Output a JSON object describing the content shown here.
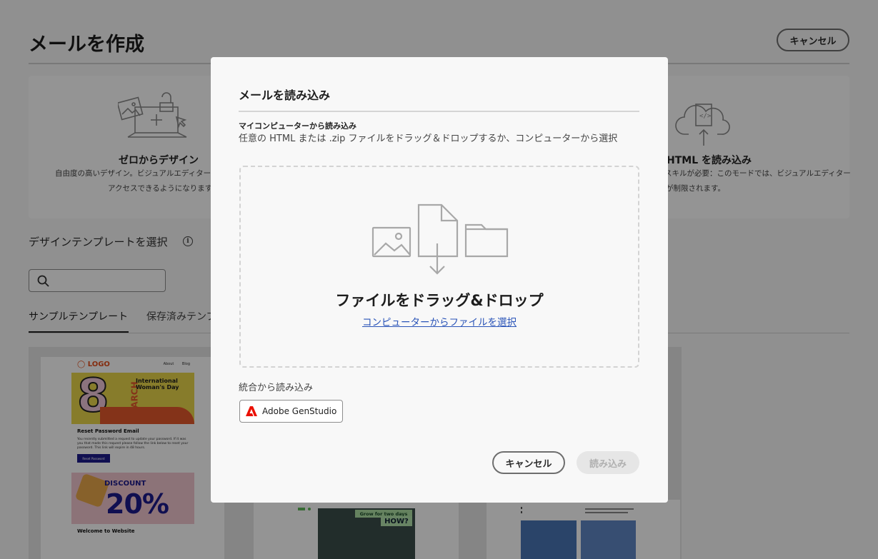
{
  "page": {
    "title": "メールを作成",
    "cancel_label": "キャンセル",
    "start_cards": [
      {
        "title": "ゼロからデザイン",
        "description_line1": "自由度の高いデザイン。ビジュアルエディターの",
        "description_line2": "アクセスできるようになります。",
        "icon": "design-from-scratch-icon"
      },
      {
        "title": "HTML を読み込み",
        "description_line1": "スキルが必要：このモードでは、ビジュアルエディター",
        "description_line2": "が制限されます。",
        "icon": "cloud-code-upload-icon"
      }
    ],
    "template_heading": "デザインテンプレートを選択",
    "search_placeholder": "",
    "tabs": [
      {
        "label": "サンプルテンプレート",
        "selected": true
      },
      {
        "label": "保存済みテンプレート",
        "selected": false
      }
    ],
    "template_thumbnail": {
      "logo": "LOGO",
      "nav": "About Blog",
      "hero_number": "8",
      "hero_month": "MARCH",
      "hero_text": "International Woman's Day",
      "reset_title": "Reset Password Email",
      "reset_body": "You recently submitted a request to update your password. If it was you that made this request please follow the link below to reset your password. This link will expire in 48 hours.",
      "reset_button": "Reset Password",
      "discount_label": "DISCOUNT",
      "discount_value": "20%",
      "welcome": "Welcome to Website",
      "grow_text": "Grow for two days",
      "how_text": "HOW?"
    }
  },
  "modal": {
    "title": "メールを読み込み",
    "section_title": "マイコンピューターから読み込み",
    "description": "任意の HTML または .zip ファイルをドラッグ＆ドロップするか、コンピューターから選択",
    "dropzone_title": "ファイルをドラッグ&ドロップ",
    "dropzone_link": "コンピューターからファイルを選択",
    "integration_label": "統合から読み込み",
    "integration_button": "Adobe GenStudio",
    "cancel_label": "キャンセル",
    "import_label": "読み込み"
  },
  "colors": {
    "link": "#2a54b8",
    "adobe_red": "#eb1000",
    "overlay": "rgba(0,0,0,0.42)"
  }
}
